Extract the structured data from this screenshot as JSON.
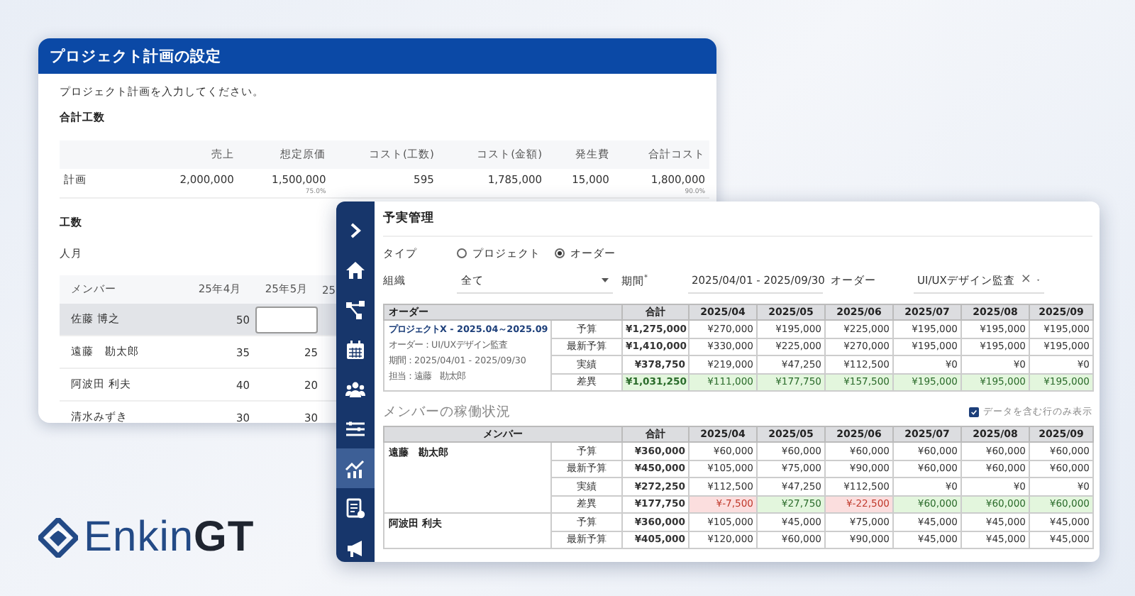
{
  "plan_window": {
    "title": "プロジェクト計画の設定",
    "instruction": "プロジェクト計画を入力してください。",
    "total_section": {
      "heading": "合計工数",
      "columns": [
        "売上",
        "想定原価",
        "コスト(工数)",
        "コスト(金額)",
        "発生費",
        "合計コスト"
      ],
      "rows": [
        {
          "label": "計画",
          "cells": [
            {
              "value": "2,000,000"
            },
            {
              "value": "1,500,000",
              "note": "75.0%"
            },
            {
              "value": "595"
            },
            {
              "value": "1,785,000"
            },
            {
              "value": "15,000"
            },
            {
              "value": "1,800,000",
              "note": "90.0%"
            }
          ]
        }
      ]
    },
    "effort_section": {
      "heading": "工数",
      "unit": "人月",
      "columns": [
        "メンバー",
        "25年4月",
        "25年5月",
        "25"
      ],
      "rows": [
        {
          "selected": true,
          "cells": [
            {
              "kind": "text",
              "text": "佐藤 博之"
            },
            {
              "kind": "text",
              "text": "50"
            },
            {
              "kind": "input"
            }
          ]
        },
        {
          "selected": false,
          "cells": [
            {
              "kind": "text",
              "text": "遠藤　勘太郎"
            },
            {
              "kind": "text",
              "text": "35"
            },
            {
              "kind": "text",
              "text": "25"
            }
          ]
        },
        {
          "selected": false,
          "cells": [
            {
              "kind": "text",
              "text": "阿波田 利夫"
            },
            {
              "kind": "text",
              "text": "40"
            },
            {
              "kind": "text",
              "text": "20"
            }
          ]
        },
        {
          "selected": false,
          "cells": [
            {
              "kind": "text",
              "text": "清水みずき"
            },
            {
              "kind": "text",
              "text": "30"
            },
            {
              "kind": "text",
              "text": "30"
            }
          ]
        }
      ]
    }
  },
  "main_window": {
    "title": "予実管理",
    "sidebar": [
      {
        "kind": "expand",
        "selected": false
      },
      {
        "kind": "home",
        "selected": false
      },
      {
        "kind": "network",
        "selected": false
      },
      {
        "kind": "calendar",
        "selected": false
      },
      {
        "kind": "team",
        "selected": false
      },
      {
        "kind": "list",
        "selected": false
      },
      {
        "kind": "chart",
        "selected": true
      },
      {
        "kind": "document",
        "selected": false
      },
      {
        "kind": "megaphone",
        "selected": false
      }
    ],
    "type_filter": {
      "label": "タイプ",
      "options": [
        {
          "label": "プロジェクト",
          "selected": false
        },
        {
          "label": "オーダー",
          "selected": true
        }
      ]
    },
    "filters": [
      {
        "label": "組織",
        "value": "全て",
        "kind": "select"
      },
      {
        "label": "期間$^{*}$",
        "value": "2025/04/01 - 2025/09/30",
        "kind": "select"
      },
      {
        "label": "オーダー",
        "value": "UI/UXデザイン監査",
        "kind": "clearable",
        "clear_icon": "×"
      }
    ],
    "order_table": {
      "columns": [
        "オーダー",
        "合計",
        "2025/04",
        "2025/05",
        "2025/06",
        "2025/07",
        "2025/08",
        "2025/09"
      ],
      "group": {
        "title": "プロジェクトX - 2025.04～2025.09",
        "details": [
          "オーダー：UI/UXデザイン監査",
          "期間：2025/04/01 - 2025/09/30",
          "担当：遠藤　勘太郎"
        ]
      },
      "rows": [
        {
          "label": "予算",
          "total": "¥1,275,000",
          "values": [
            "¥270,000",
            "¥195,000",
            "¥225,000",
            "¥195,000",
            "¥195,000",
            "¥195,000"
          ]
        },
        {
          "label": "最新予算",
          "total": "¥1,410,000",
          "values": [
            "¥330,000",
            "¥225,000",
            "¥270,000",
            "¥195,000",
            "¥195,000",
            "¥195,000"
          ]
        },
        {
          "label": "実績",
          "total": "¥378,750",
          "values": [
            "¥219,000",
            "¥47,250",
            "¥112,500",
            "¥0",
            "¥0",
            "¥0"
          ]
        },
        {
          "label": "差異",
          "total": "¥1,031,250",
          "highlighted": true,
          "total_highlighted": true,
          "values": [
            "¥111,000",
            "¥177,750",
            "¥157,500",
            "¥195,000",
            "¥195,000",
            "¥195,000"
          ],
          "negative": [
            false,
            false,
            false,
            false,
            false,
            false
          ]
        }
      ]
    },
    "members_section": {
      "heading": "メンバーの稼働状況",
      "filter": {
        "label": "データを含む行のみ表示",
        "checked": true
      },
      "columns": [
        "メンバー",
        "合計",
        "2025/04",
        "2025/05",
        "2025/06",
        "2025/07",
        "2025/08",
        "2025/09"
      ],
      "members": [
        {
          "name": "遠藤　勘太郎",
          "rows": [
            {
              "label": "予算",
              "total": "¥360,000",
              "values": [
                "¥60,000",
                "¥60,000",
                "¥60,000",
                "¥60,000",
                "¥60,000",
                "¥60,000"
              ]
            },
            {
              "label": "最新予算",
              "total": "¥450,000",
              "values": [
                "¥105,000",
                "¥75,000",
                "¥90,000",
                "¥60,000",
                "¥60,000",
                "¥60,000"
              ]
            },
            {
              "label": "実績",
              "total": "¥272,250",
              "values": [
                "¥112,500",
                "¥47,250",
                "¥112,500",
                "¥0",
                "¥0",
                "¥0"
              ]
            },
            {
              "label": "差異",
              "total": "¥177,750",
              "values": [
                "¥-7,500",
                "¥27,750",
                "¥-22,500",
                "¥60,000",
                "¥60,000",
                "¥60,000"
              ],
              "highlighted": true,
              "total_highlighted": false,
              "negative": [
                true,
                false,
                true,
                false,
                false,
                false
              ]
            }
          ]
        },
        {
          "name": "阿波田 利夫",
          "rows": [
            {
              "label": "予算",
              "total": "¥360,000",
              "values": [
                "¥105,000",
                "¥45,000",
                "¥75,000",
                "¥45,000",
                "¥45,000",
                "¥45,000"
              ]
            },
            {
              "label": "最新予算",
              "total": "¥405,000",
              "values": [
                "¥120,000",
                "¥60,000",
                "¥90,000",
                "¥45,000",
                "¥45,000",
                "¥45,000"
              ]
            }
          ]
        }
      ]
    }
  },
  "logo": {
    "text": "Enkin**GT**"
  }
}
